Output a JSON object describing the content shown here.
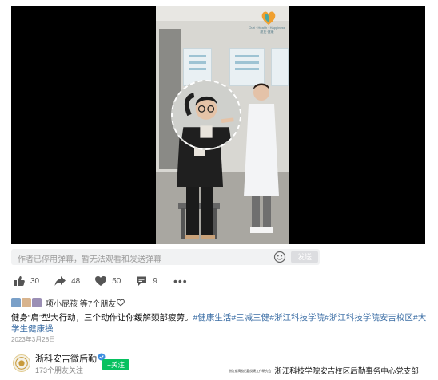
{
  "video": {
    "logo_text": "Ouri · Health · Happiness",
    "logo_caption": "朋友·健康"
  },
  "danmu": {
    "placeholder": "作者已停用弹幕，暂无法观看和发送弹幕",
    "send_label": "发送"
  },
  "actions": {
    "like_count": "30",
    "share_count": "48",
    "love_count": "50",
    "comment_count": "9"
  },
  "liked_by": {
    "text": "项小屁孩 等7个朋友"
  },
  "post": {
    "text": "健身“肩”型大行动，三个动作让你缓解颈部疲劳。",
    "tags": [
      "#健康生活",
      "#三减三健",
      "#浙江科技学院",
      "#浙江科技学院安吉校区",
      "#大学生健康操"
    ],
    "date": "2023年3月28日"
  },
  "account": {
    "name": "浙科安吉微后勤",
    "friends": "173个朋友关注",
    "follow_label": "+关注",
    "watermark_small": "浙江省高校后勤党建工作研究会",
    "watermark": "浙江科技学院安吉校区后勤事务中心党支部"
  },
  "colors": {
    "accent_green": "#07c160",
    "tag_blue": "#3b6ea5"
  }
}
